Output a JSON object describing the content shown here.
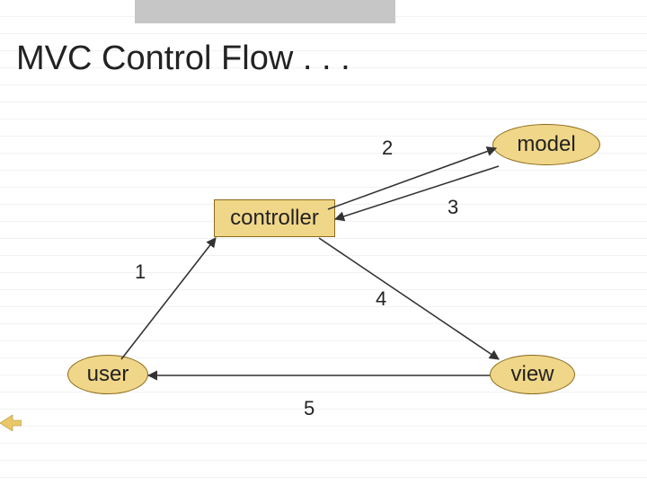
{
  "title": "MVC Control Flow . . .",
  "nodes": {
    "model": "model",
    "controller": "controller",
    "user": "user",
    "view": "view"
  },
  "edge_labels": {
    "e1": "1",
    "e2": "2",
    "e3": "3",
    "e4": "4",
    "e5": "5"
  }
}
